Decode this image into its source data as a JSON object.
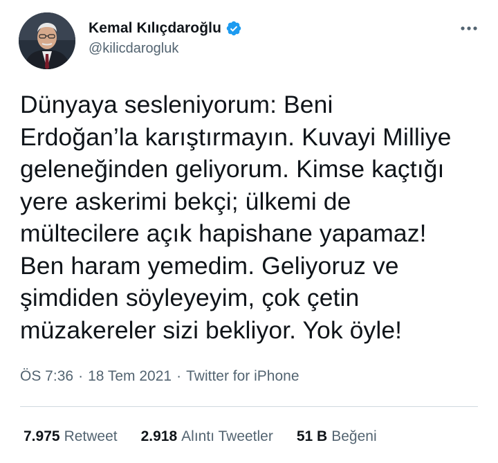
{
  "user": {
    "display_name": "Kemal Kılıçdaroğlu",
    "handle": "@kilicdarogluk",
    "verified": true
  },
  "tweet": {
    "text": "Dünyaya sesleniyorum: Beni\nErdoğan’la karıştırmayın. Kuvayi Milliye\ngeleneğinden geliyorum. Kimse kaçtığı\nyere askerimi bekçi; ülkemi de\nmültecilere açık hapishane yapamaz!\nBen haram yemedim. Geliyoruz ve\nşimdiden söyleyeyim, çok çetin\nmüzakereler sizi bekliyor. Yok öyle!"
  },
  "meta": {
    "time": "ÖS 7:36",
    "separator": "·",
    "date": "18 Tem 2021",
    "source": "Twitter for iPhone"
  },
  "stats": {
    "retweets_count": "7.975",
    "retweets_label": "Retweet",
    "quotes_count": "2.918",
    "quotes_label": "Alıntı Tweetler",
    "likes_count": "51 B",
    "likes_label": "Beğeni"
  },
  "colors": {
    "text_primary": "#0f1419",
    "text_secondary": "#536471",
    "verified_blue": "#1d9bf0",
    "divider": "#cfd9de"
  },
  "icons": {
    "verified": "verified-badge-icon",
    "more": "more-horizontal-icon"
  }
}
